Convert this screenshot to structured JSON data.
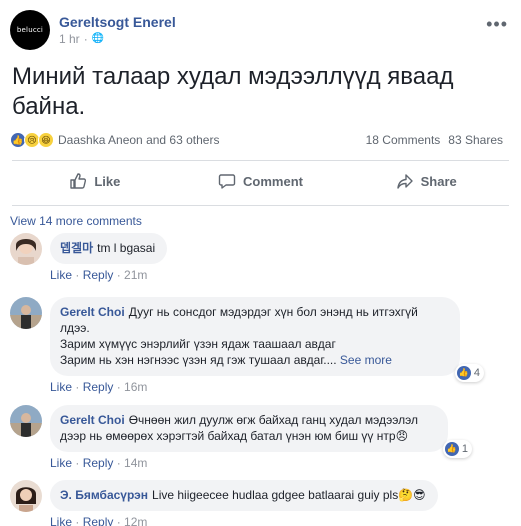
{
  "post": {
    "page_name": "Gereltsogt Enerel",
    "avatar_text": "belucci",
    "time": "1 hr",
    "privacy_glyph": "🌐",
    "more_glyph": "•••",
    "text": "Миний талаар худал мэдээллүүд яваад байна.",
    "reactors": "Daashka Aneon and 63 others",
    "comments_count": "18 Comments",
    "shares_count": "83 Shares"
  },
  "actions": {
    "like": "Like",
    "comment": "Comment",
    "share": "Share"
  },
  "comments_section": {
    "view_more": "View 14 more comments",
    "separator": " · ",
    "like_label": "Like",
    "reply_label": "Reply",
    "items": [
      {
        "author": "뎁겔마",
        "text": "tm l bgasai",
        "time": "21m"
      },
      {
        "author": "Gerelt Choi",
        "line1": "Дууг нь сонсдог мэдэрдэг хүн бол энэнд нь итгэхгүй",
        "line2": "лдээ.",
        "line3": "Зарим хүмүүс энэрлийг үзэн ядаж таашаал авдаг",
        "line4": "Зарим нь хэн нэгнээс үзэн яд гэж тушаал авдаг....",
        "see_more": "See more",
        "likes": "4",
        "time": "16m"
      },
      {
        "author": "Gerelt Choi",
        "line1": "Өчнөөн жил дуулж өгж байхад ганц худал мэдээлэл",
        "line2": "дээр нь өмөөрөх хэрэгтэй байхад батал үнэн юм биш үү нтр",
        "emoji": "😠",
        "likes": "1",
        "time": "14m"
      },
      {
        "author": "Э. Бямбасүрэн",
        "text": "Live hiigeecee hudlaa gdgee batlaarai guiy pls",
        "emoji": "🤔😎",
        "time": "12m"
      }
    ]
  }
}
